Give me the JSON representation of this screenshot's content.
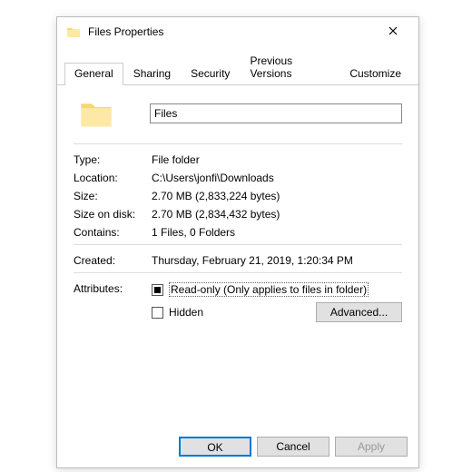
{
  "window": {
    "title": "Files Properties"
  },
  "tabs": {
    "general": "General",
    "sharing": "Sharing",
    "security": "Security",
    "previous": "Previous Versions",
    "customize": "Customize"
  },
  "name": {
    "value": "Files"
  },
  "fields": {
    "type_label": "Type:",
    "type_value": "File folder",
    "location_label": "Location:",
    "location_value": "C:\\Users\\jonfi\\Downloads",
    "size_label": "Size:",
    "size_value": "2.70 MB (2,833,224 bytes)",
    "sizeondisk_label": "Size on disk:",
    "sizeondisk_value": "2.70 MB (2,834,432 bytes)",
    "contains_label": "Contains:",
    "contains_value": "1 Files, 0 Folders",
    "created_label": "Created:",
    "created_value": "Thursday, February 21, 2019, 1:20:34 PM",
    "attrs_label": "Attributes:",
    "readonly_label": "Read-only (Only applies to files in folder)",
    "hidden_label": "Hidden",
    "advanced_label": "Advanced..."
  },
  "buttons": {
    "ok": "OK",
    "cancel": "Cancel",
    "apply": "Apply"
  }
}
